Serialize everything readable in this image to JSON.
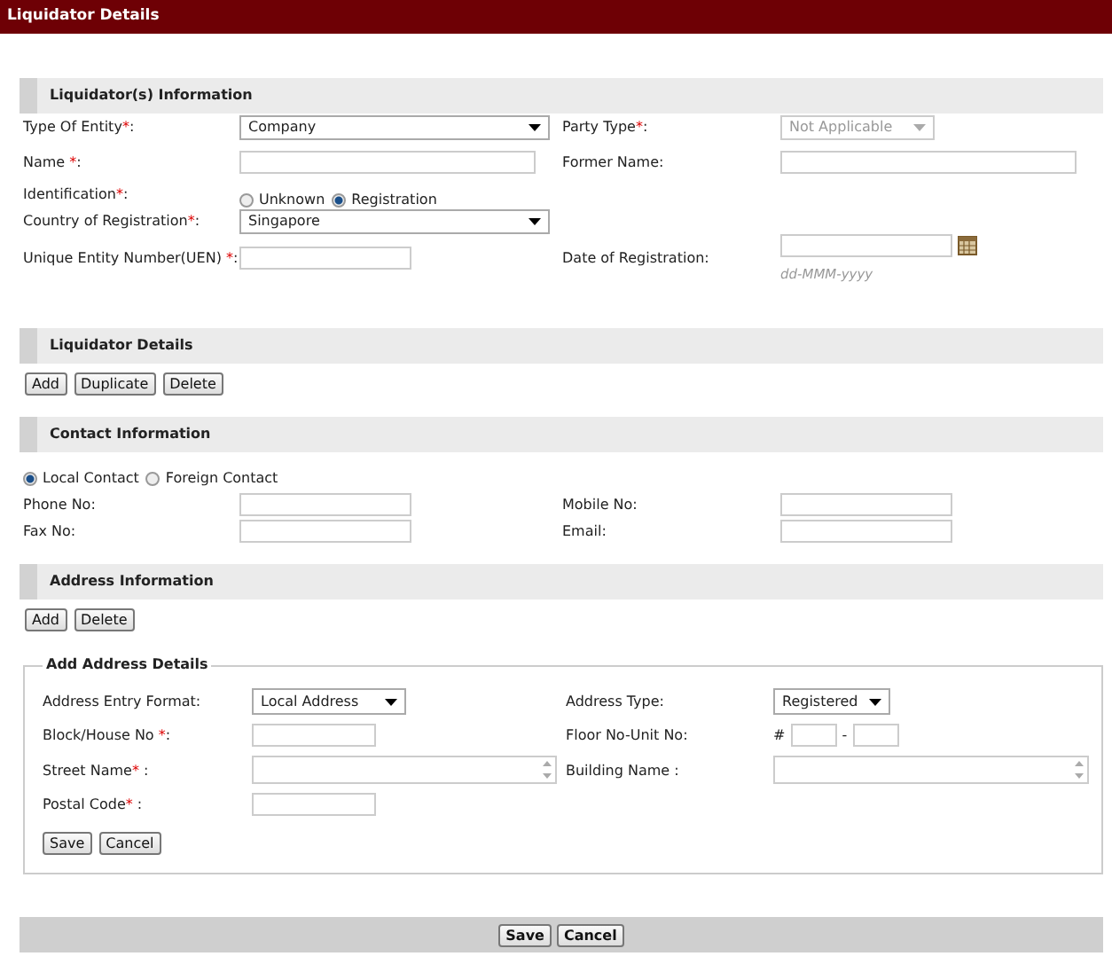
{
  "title": "Liquidator Details",
  "sections": [
    {
      "heading": "Liquidator(s) Information",
      "rows": [
        [
          {
            "label": "Type Of Entity",
            "mark": "*",
            "tail": ":",
            "kind": "select",
            "value": "Company",
            "disabled": false
          },
          {
            "label": "Party Type",
            "mark": "*",
            "tail": ":",
            "kind": "select-small",
            "value": "Not Applicable",
            "disabled": true
          }
        ],
        [
          {
            "label": "Name ",
            "mark": "*",
            "tail": ":",
            "kind": "text"
          },
          {
            "label": "Former Name:",
            "kind": "text"
          }
        ],
        [
          {
            "label": "Identification",
            "mark": "*",
            "tail": ":",
            "kind": "radio",
            "options": [
              {
                "label": "Unknown",
                "selected": false
              },
              {
                "label": "Registration",
                "selected": true
              }
            ]
          }
        ],
        [
          {
            "label": "Country of Registration",
            "mark": "*",
            "tail": ":",
            "kind": "select",
            "value": "Singapore",
            "disabled": false
          }
        ],
        [
          {
            "label": "Unique Entity Number(UEN) ",
            "mark": "*",
            "tail": ":",
            "kind": "text-short"
          },
          {
            "label": "Date of Registration:",
            "kind": "date",
            "hint": "dd-MMM-yyyy"
          }
        ]
      ]
    },
    {
      "heading": "Liquidator Details",
      "buttons": [
        "Add",
        "Duplicate",
        "Delete"
      ]
    },
    {
      "heading": "Contact Information",
      "radios": [
        {
          "label": "Local Contact",
          "selected": true
        },
        {
          "label": "Foreign Contact",
          "selected": false
        }
      ],
      "rows": [
        [
          {
            "label": "Phone No:",
            "kind": "text-short"
          },
          {
            "label": "Mobile No:",
            "kind": "text-short"
          }
        ],
        [
          {
            "label": "Fax No:",
            "kind": "text-short"
          },
          {
            "label": "Email:",
            "kind": "text-short"
          }
        ]
      ]
    },
    {
      "heading": "Address Information",
      "buttons": [
        "Add",
        "Delete"
      ],
      "fieldset": {
        "legend": "Add Address Details",
        "rows": [
          [
            {
              "label": "Address Entry Format:",
              "kind": "select-small",
              "value": "Local Address",
              "disabled": false
            },
            {
              "label": "Address Type:",
              "kind": "select-tiny",
              "value": "Registered",
              "disabled": false
            }
          ],
          [
            {
              "label": "Block/House No ",
              "mark": "*",
              "tail": ":",
              "kind": "text-short"
            },
            {
              "label": "Floor No-Unit No:",
              "kind": "unit",
              "prefix": "#",
              "separator": "-"
            }
          ],
          [
            {
              "label": "Street Name",
              "mark": "*",
              "tail": " :",
              "kind": "textarea"
            },
            {
              "label": "Building Name :",
              "kind": "textarea"
            }
          ],
          [
            {
              "label": "Postal Code",
              "mark": "*",
              "tail": " :",
              "kind": "text-short"
            }
          ]
        ],
        "buttons": [
          "Save",
          "Cancel"
        ]
      }
    }
  ],
  "footer_buttons": [
    "Save",
    "Cancel"
  ]
}
